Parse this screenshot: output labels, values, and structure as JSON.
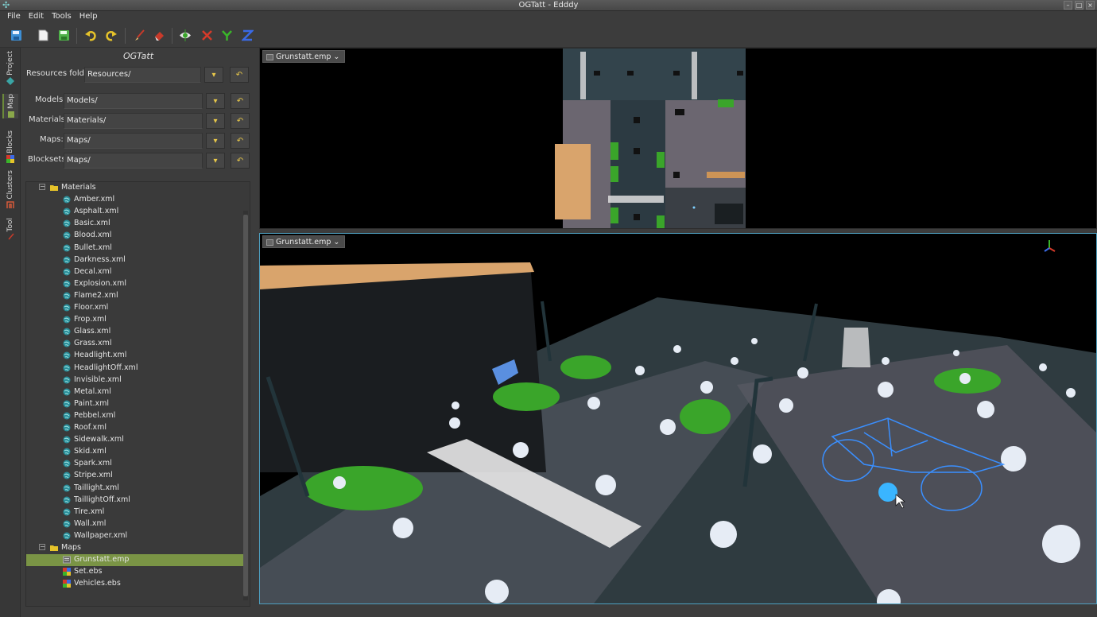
{
  "window": {
    "title": "OGTatt - Edddy"
  },
  "menu": [
    "File",
    "Edit",
    "Tools",
    "Help"
  ],
  "toolbar": {
    "icons": [
      "save-icon",
      "new-file-icon",
      "save-all-icon",
      "undo-icon",
      "redo-icon",
      "brush-tool-icon",
      "eraser-tool-icon",
      "eye-view-icon",
      "x-axis-icon",
      "y-axis-icon",
      "z-axis-icon"
    ]
  },
  "side_tabs": [
    "Project",
    "Map",
    "Blocks",
    "Clusters",
    "Tool"
  ],
  "project": {
    "title": "OGTatt",
    "resources_label": "Resources folder:",
    "resources_value": "Resources/",
    "models_label": "Models:",
    "models_value": "Models/",
    "materials_label": "Materials:",
    "materials_value": "Materials/",
    "maps_label": "Maps:",
    "maps_value": "Maps/",
    "blocksets_label": "Blocksets:",
    "blocksets_value": "Maps/"
  },
  "tree": {
    "materials_folder": "Materials",
    "materials": [
      "Amber.xml",
      "Asphalt.xml",
      "Basic.xml",
      "Blood.xml",
      "Bullet.xml",
      "Darkness.xml",
      "Decal.xml",
      "Explosion.xml",
      "Flame2.xml",
      "Floor.xml",
      "Frop.xml",
      "Glass.xml",
      "Grass.xml",
      "Headlight.xml",
      "HeadlightOff.xml",
      "Invisible.xml",
      "Metal.xml",
      "Paint.xml",
      "Pebbel.xml",
      "Roof.xml",
      "Sidewalk.xml",
      "Skid.xml",
      "Spark.xml",
      "Stripe.xml",
      "Taillight.xml",
      "TaillightOff.xml",
      "Tire.xml",
      "Wall.xml",
      "Wallpaper.xml"
    ],
    "maps_folder": "Maps",
    "maps": [
      "Grunstatt.emp",
      "Set.ebs",
      "Vehicles.ebs"
    ],
    "selected": "Grunstatt.emp"
  },
  "viewports": {
    "top_tab": "Grunstatt.emp",
    "main_tab": "Grunstatt.emp"
  },
  "colors": {
    "accent": "#7a9445",
    "viewport_border": "#4ea0c0",
    "car_green": "#3aa52a",
    "building_tan": "#d9a46c"
  }
}
